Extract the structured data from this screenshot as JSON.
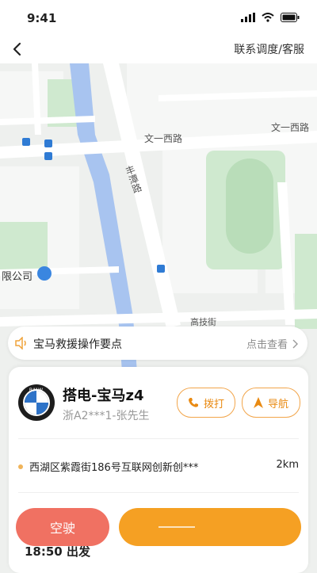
{
  "status_bar": {
    "time": "9:41"
  },
  "header": {
    "contact_label": "联系调度/客服"
  },
  "map": {
    "road_labels": [
      "文一西路",
      "文一西路",
      "丰潭路",
      "高技街"
    ],
    "poi_label": "限公司"
  },
  "tip": {
    "text": "宝马救援操作要点",
    "link": "点击查看"
  },
  "order": {
    "brand_logo_text": "BMW",
    "car_title": "搭电-宝马z4",
    "plate_and_owner": "浙A2***1-张先生",
    "call_label": "拨打",
    "navigate_label": "导航",
    "address": "西湖区紫霞街186号互联网创新创***",
    "distance": "2km",
    "depart_time": "18:50",
    "depart_label": "出发"
  },
  "actions": {
    "empty_label": "空驶",
    "main_label": ""
  },
  "colors": {
    "accent": "#f5a023",
    "danger": "#f07162",
    "river": "#a8c4f0",
    "green": "#cfe9cf"
  }
}
